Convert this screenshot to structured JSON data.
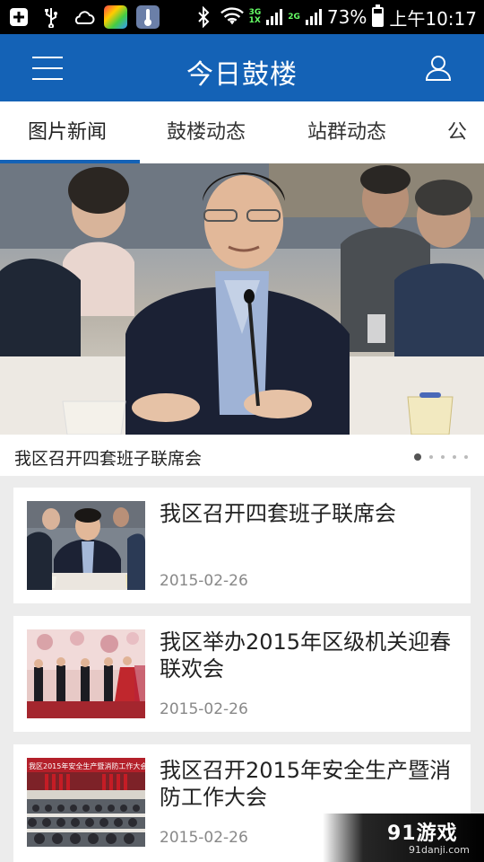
{
  "status_bar": {
    "network_tags": [
      "3G",
      "1X",
      "2G"
    ],
    "battery": "73%",
    "time": "上午10:17"
  },
  "app_bar": {
    "title": "今日鼓楼"
  },
  "tabs": [
    {
      "label": "图片新闻",
      "active": true
    },
    {
      "label": "鼓楼动态",
      "active": false
    },
    {
      "label": "站群动态",
      "active": false
    },
    {
      "label": "公示",
      "active": false
    }
  ],
  "banner": {
    "caption": "我区召开四套班子联席会",
    "slide_count": 5,
    "active_slide": 1
  },
  "news": [
    {
      "title": "我区召开四套班子联席会",
      "date": "2015-02-26"
    },
    {
      "title": "我区举办2015年区级机关迎春联欢会",
      "date": "2015-02-26"
    },
    {
      "title": "我区召开2015年安全生产暨消防工作大会",
      "date": "2015-02-26"
    }
  ],
  "thumb3_banner_text": "我区2015年安全生产暨消防工作大会",
  "watermark": {
    "logo": "91游戏",
    "site": "91danji.com"
  },
  "colors": {
    "primary": "#1462b6",
    "background": "#ececec"
  }
}
